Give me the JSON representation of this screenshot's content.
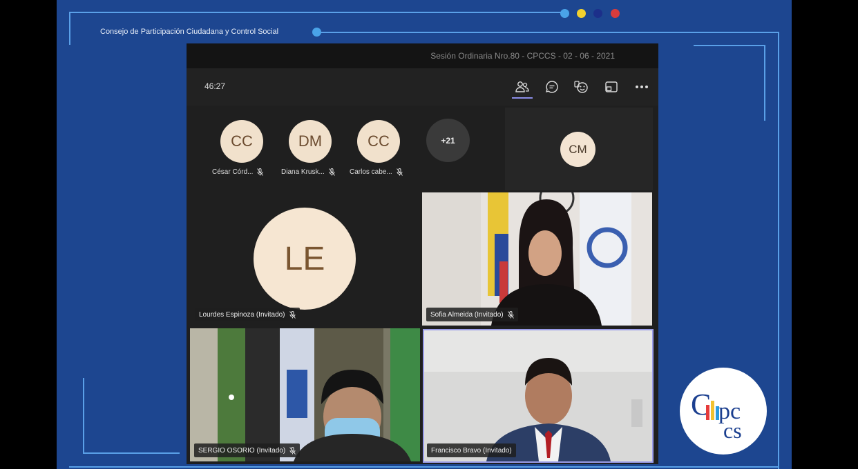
{
  "org": {
    "title": "Consejo de Participación Ciudadana y Control Social"
  },
  "dots": [
    "#4aa3e8",
    "#f2d12e",
    "#1c2f8a",
    "#d93c3c"
  ],
  "meeting": {
    "window_title": "Sesión Ordinaria Nro.80 - CPCCS - 02 - 06 - 2021",
    "timer": "46:27",
    "toolbar_icons": [
      "people-icon",
      "chat-icon",
      "reactions-icon",
      "share-tray-icon",
      "more-options-icon"
    ]
  },
  "strip_participants": [
    {
      "initials": "CC",
      "name": "César Córd..."
    },
    {
      "initials": "DM",
      "name": "Diana Krusk..."
    },
    {
      "initials": "CC",
      "name": "Carlos cabe..."
    }
  ],
  "overflow_count": "+21",
  "cm_tile": {
    "initials": "CM"
  },
  "tiles": [
    {
      "initials": "LE",
      "name": "Lourdes Espinoza (Invitado)"
    },
    {
      "name": "Sofia Almeida (Invitado)"
    },
    {
      "name": "SERGIO OSORIO (Invitado)"
    },
    {
      "name": "Francisco Bravo (Invitado)"
    }
  ],
  "logo": {
    "text": "CPCCS"
  }
}
